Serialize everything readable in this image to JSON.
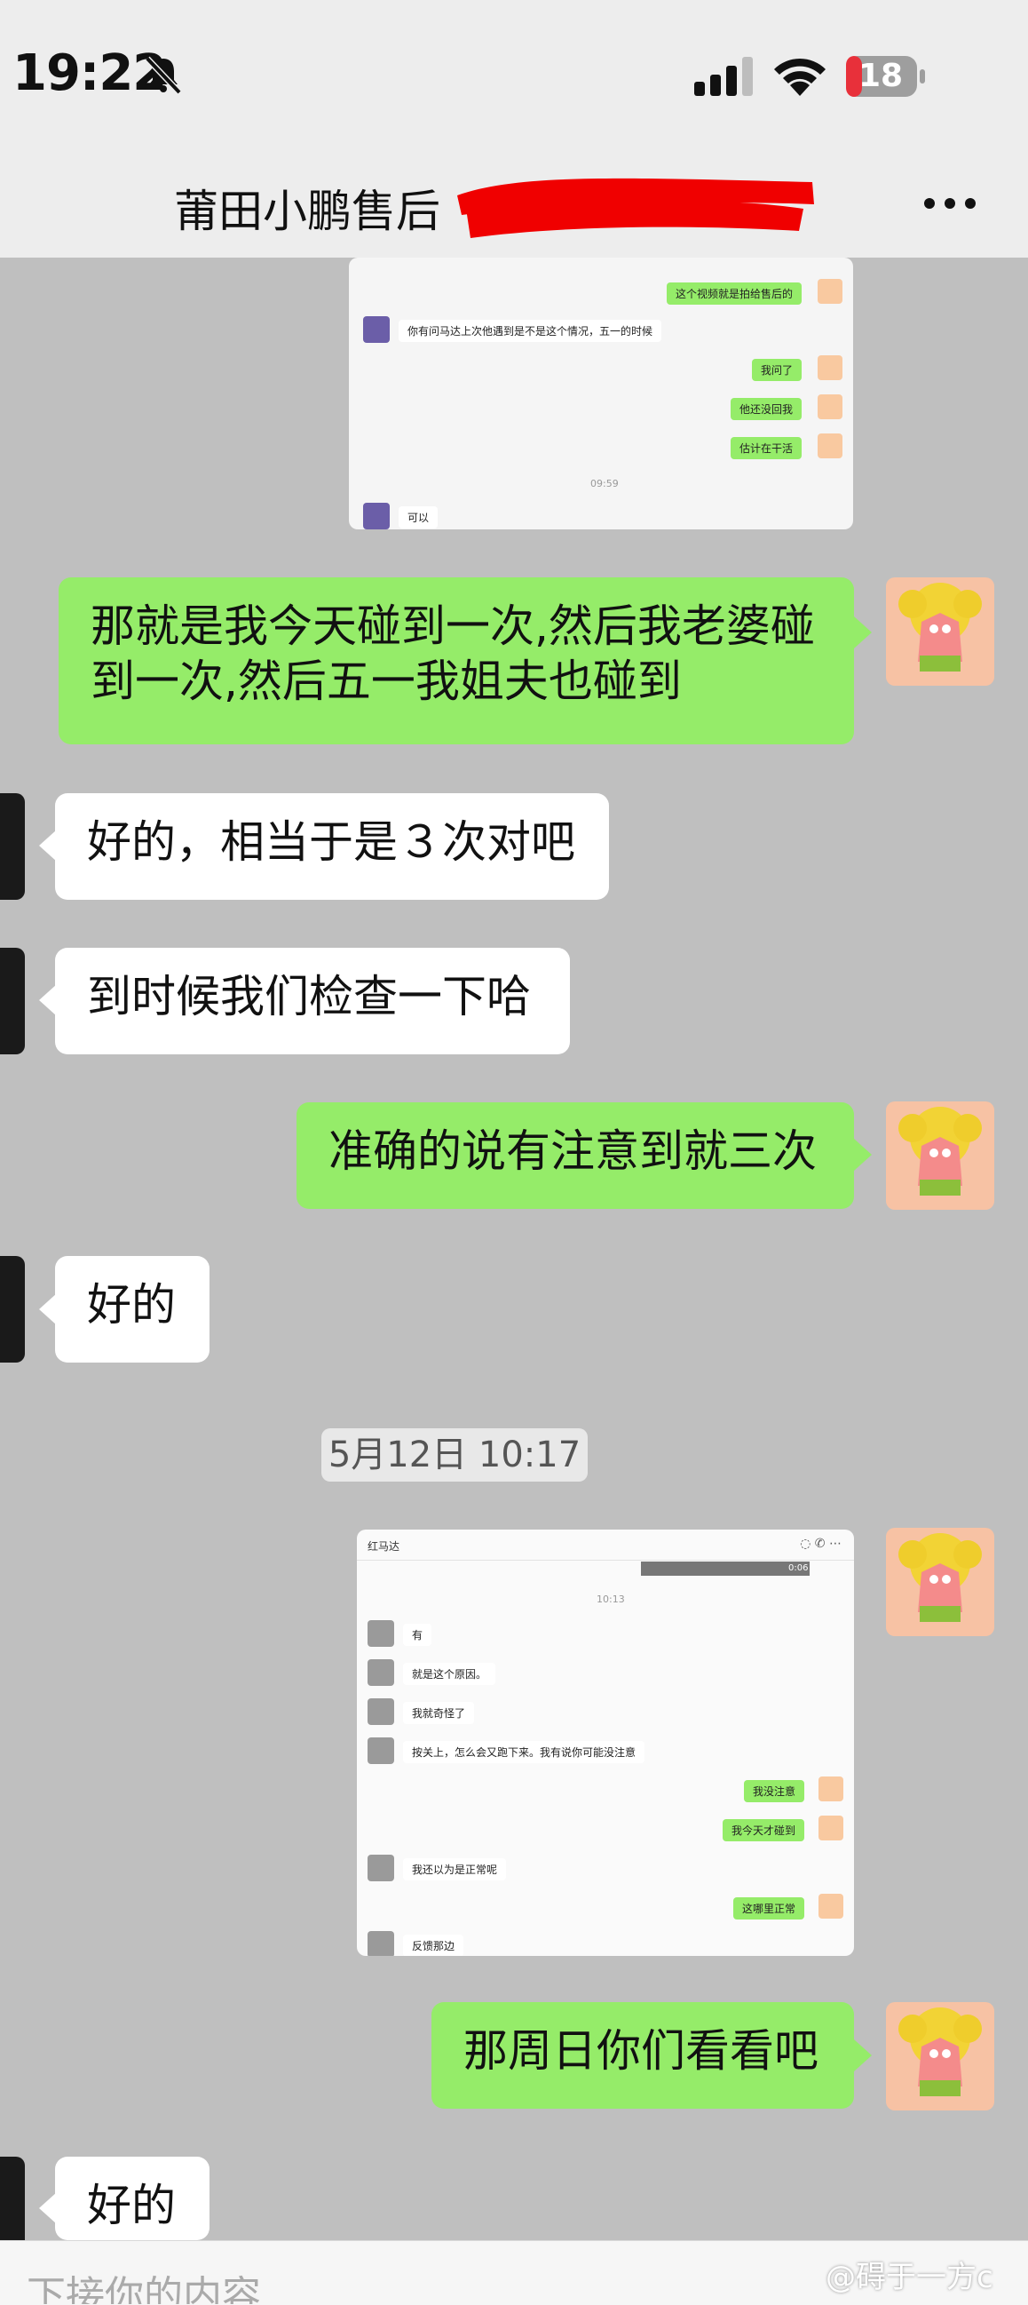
{
  "status_bar": {
    "time": "19:22",
    "battery": "18",
    "silent_icon": "bell-slash-icon",
    "signal_icon": "cellular-signal-icon",
    "wifi_icon": "wifi-icon"
  },
  "header": {
    "title": "莆田小鹏售后",
    "more_icon": "more-horizontal-icon"
  },
  "screenshot1": {
    "rows": [
      {
        "side": "me",
        "text": "这个视频就是拍给售后的"
      },
      {
        "side": "them",
        "text": "你有问马达上次他遇到是不是这个情况，五一的时候"
      },
      {
        "side": "me",
        "text": "我问了"
      },
      {
        "side": "me",
        "text": "他还没回我"
      },
      {
        "side": "me",
        "text": "估计在干活"
      },
      {
        "side": "time",
        "text": "09:59"
      },
      {
        "side": "them",
        "text": "可以"
      }
    ]
  },
  "messages": [
    {
      "side": "me",
      "text": "那就是我今天碰到一次,然后我老婆碰到一次,然后五一我姐夫也碰到"
    },
    {
      "side": "them",
      "text": "好的，相当于是３次对吧"
    },
    {
      "side": "them",
      "text": "到时候我们检查一下哈"
    },
    {
      "side": "me",
      "text": "准确的说有注意到就三次"
    },
    {
      "side": "them",
      "text": "好的"
    }
  ],
  "timestamp": "5月12日 10:17",
  "screenshot2": {
    "contact": "红马达",
    "video_duration": "0:06",
    "time": "10:13",
    "rows": [
      {
        "side": "them",
        "text": "有"
      },
      {
        "side": "them",
        "text": "就是这个原因。"
      },
      {
        "side": "them",
        "text": "我就奇怪了"
      },
      {
        "side": "them",
        "text": "按关上，怎么会又跑下来。我有说你可能没注意"
      },
      {
        "side": "me",
        "text": "我没注意"
      },
      {
        "side": "me",
        "text": "我今天才碰到"
      },
      {
        "side": "them",
        "text": "我还以为是正常呢"
      },
      {
        "side": "me",
        "text": "这哪里正常"
      },
      {
        "side": "them",
        "text": "反馈那边"
      }
    ]
  },
  "messages2": [
    {
      "side": "me",
      "text": "那周日你们看看吧"
    },
    {
      "side": "them",
      "text": "好的"
    }
  ],
  "input": {
    "placeholder": "下接你的内容"
  },
  "watermark": "@碍于一方c",
  "colors": {
    "me_bubble": "#95ec69",
    "them_bubble": "#ffffff",
    "chat_bg": "#bfbfbf",
    "header_bg": "#ededed"
  }
}
